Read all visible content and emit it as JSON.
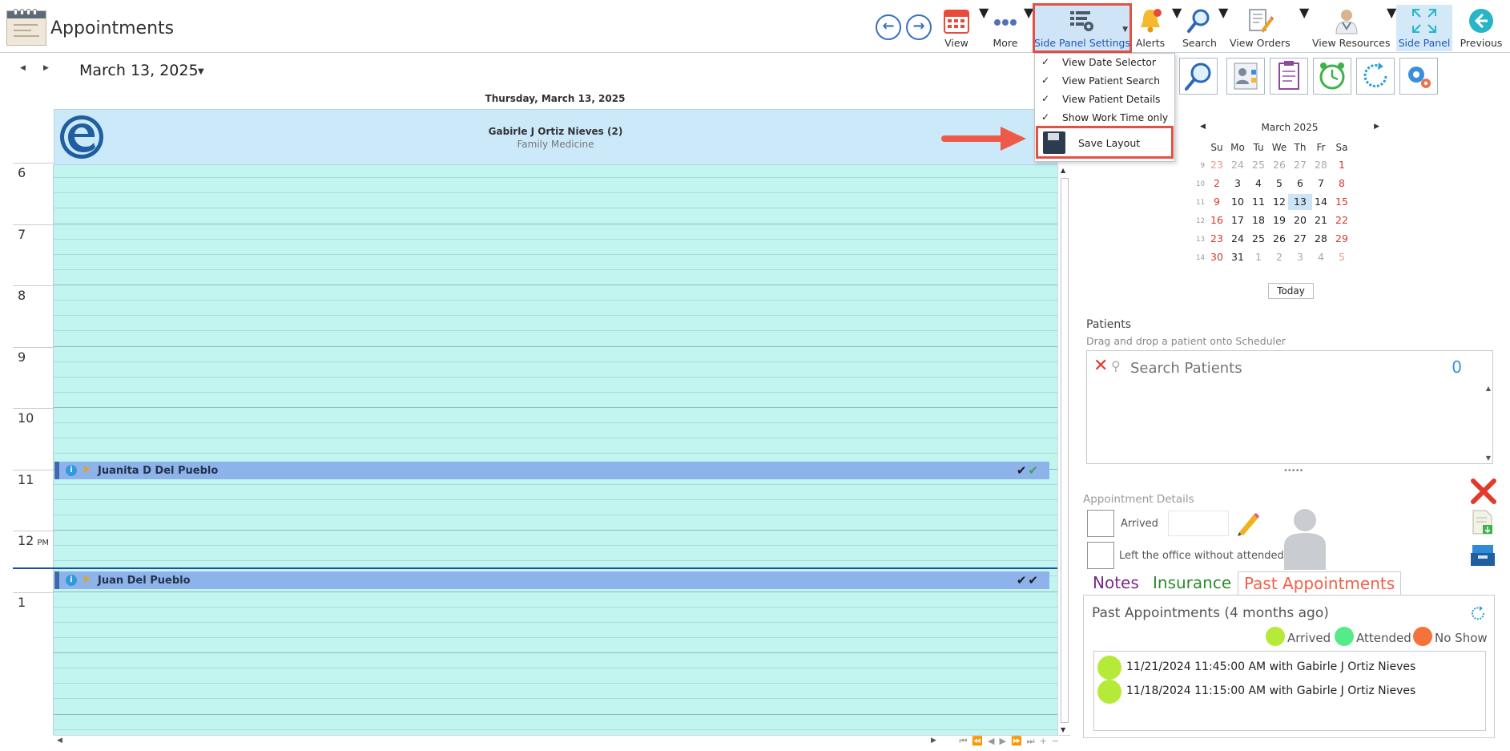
{
  "app": {
    "title": "Appointments"
  },
  "toolbar": {
    "view": "View",
    "more": "More",
    "side_panel_settings": "Side Panel Settings",
    "alerts": "Alerts",
    "search": "Search",
    "view_orders": "View Orders",
    "view_resources": "View Resources",
    "side_panel": "Side Panel",
    "previous": "Previous"
  },
  "side_panel_menu": {
    "items": [
      {
        "label": "View Date Selector",
        "checked": true
      },
      {
        "label": "View Patient Search",
        "checked": true
      },
      {
        "label": "View Patient Details",
        "checked": true
      },
      {
        "label": "Show Work Time only",
        "checked": true
      }
    ],
    "save_layout": "Save Layout"
  },
  "scheduler": {
    "date_title": "March 13, 2025",
    "day_header": "Thursday, March 13, 2025",
    "resource": {
      "name": "Gabirle J Ortiz Nieves (2)",
      "specialty": "Family Medicine"
    },
    "hours": [
      {
        "label": "6",
        "ampm": ""
      },
      {
        "label": "7",
        "ampm": ""
      },
      {
        "label": "8",
        "ampm": ""
      },
      {
        "label": "9",
        "ampm": ""
      },
      {
        "label": "10",
        "ampm": ""
      },
      {
        "label": "11",
        "ampm": ""
      },
      {
        "label": "12",
        "ampm": "PM"
      },
      {
        "label": "1",
        "ampm": ""
      }
    ],
    "appointments": [
      {
        "patient": "Juanita D Del Pueblo",
        "checks": [
          "✔",
          "✔"
        ],
        "check_colors": [
          "#1b1b1b",
          "#3aa84a"
        ]
      },
      {
        "patient": "Juan Del Pueblo",
        "checks": [
          "✔",
          "✔"
        ],
        "check_colors": [
          "#1b1b1b",
          "#1b1b1b"
        ]
      }
    ],
    "colors": {
      "grid_bg": "#c2f5ef",
      "appointment": "#8eb3ea",
      "now_line": "#1e4f9c"
    }
  },
  "mini_calendar": {
    "title": "March 2025",
    "days_of_week": [
      "Su",
      "Mo",
      "Tu",
      "We",
      "Th",
      "Fr",
      "Sa"
    ],
    "weeks": [
      {
        "wk": "9",
        "days": [
          "23",
          "24",
          "25",
          "26",
          "27",
          "28",
          "1"
        ]
      },
      {
        "wk": "10",
        "days": [
          "2",
          "3",
          "4",
          "5",
          "6",
          "7",
          "8"
        ]
      },
      {
        "wk": "11",
        "days": [
          "9",
          "10",
          "11",
          "12",
          "13",
          "14",
          "15"
        ]
      },
      {
        "wk": "12",
        "days": [
          "16",
          "17",
          "18",
          "19",
          "20",
          "21",
          "22"
        ]
      },
      {
        "wk": "13",
        "days": [
          "23",
          "24",
          "25",
          "26",
          "27",
          "28",
          "29"
        ]
      },
      {
        "wk": "14",
        "days": [
          "30",
          "31",
          "1",
          "2",
          "3",
          "4",
          "5"
        ]
      }
    ],
    "selected_day": "13",
    "today_button": "Today"
  },
  "patients": {
    "title": "Patients",
    "hint": "Drag and drop a patient onto Scheduler",
    "search_placeholder": "Search Patients",
    "count": "0"
  },
  "appointment_details": {
    "title": "Appointment Details",
    "arrived_label": "Arrived",
    "left_label": "Left the office without attended"
  },
  "tabs": {
    "notes": "Notes",
    "insurance": "Insurance",
    "past": "Past Appointments"
  },
  "past_appointments": {
    "title": "Past Appointments (4 months ago)",
    "legend": [
      {
        "label": "Arrived",
        "color": "#b6ea38"
      },
      {
        "label": "Attended",
        "color": "#55ea8a"
      },
      {
        "label": "No Show",
        "color": "#f4733a"
      }
    ],
    "items": [
      "11/21/2024 11:45:00 AM with Gabirle J Ortiz Nieves",
      "11/18/2024 11:15:00 AM with Gabirle J Ortiz Nieves"
    ]
  }
}
